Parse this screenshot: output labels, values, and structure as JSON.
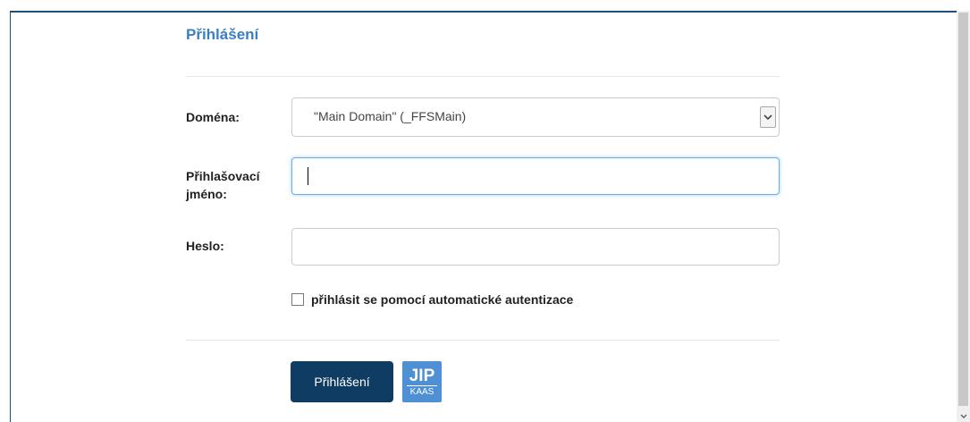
{
  "login": {
    "title": "Přihlášení",
    "domain_label": "Doména:",
    "domain_value": "\"Main Domain\" (_FFSMain)",
    "username_label_line1": "Přihlašovací",
    "username_label_line2": "jméno:",
    "username_value": "",
    "password_label": "Heslo:",
    "password_value": "",
    "auto_auth_label": "přihlásit se pomocí automatické autentizace",
    "auto_auth_checked": false,
    "submit_label": "Přihlášení"
  },
  "logo": {
    "top": "JIP",
    "bottom": "KAAS"
  },
  "icons": {
    "select_arrow": "chevron-down-icon",
    "scroll_arrow": "scroll-down-icon"
  },
  "colors": {
    "title": "#3c7fbf",
    "button": "#0f3c63",
    "logo": "#4f8fd3",
    "focus": "#66afe9"
  }
}
